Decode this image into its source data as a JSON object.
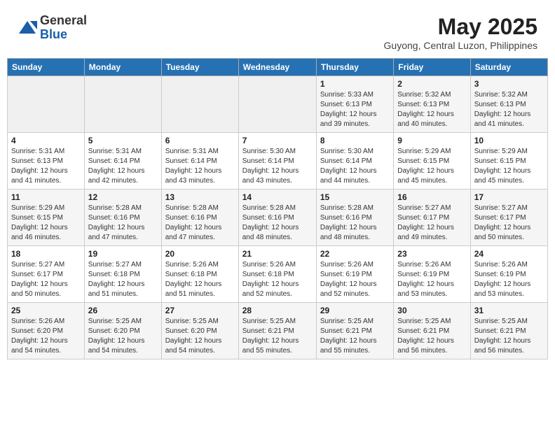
{
  "header": {
    "logo_general": "General",
    "logo_blue": "Blue",
    "month_year": "May 2025",
    "location": "Guyong, Central Luzon, Philippines"
  },
  "weekdays": [
    "Sunday",
    "Monday",
    "Tuesday",
    "Wednesday",
    "Thursday",
    "Friday",
    "Saturday"
  ],
  "weeks": [
    [
      {
        "day": "",
        "info": ""
      },
      {
        "day": "",
        "info": ""
      },
      {
        "day": "",
        "info": ""
      },
      {
        "day": "",
        "info": ""
      },
      {
        "day": "1",
        "info": "Sunrise: 5:33 AM\nSunset: 6:13 PM\nDaylight: 12 hours\nand 39 minutes."
      },
      {
        "day": "2",
        "info": "Sunrise: 5:32 AM\nSunset: 6:13 PM\nDaylight: 12 hours\nand 40 minutes."
      },
      {
        "day": "3",
        "info": "Sunrise: 5:32 AM\nSunset: 6:13 PM\nDaylight: 12 hours\nand 41 minutes."
      }
    ],
    [
      {
        "day": "4",
        "info": "Sunrise: 5:31 AM\nSunset: 6:13 PM\nDaylight: 12 hours\nand 41 minutes."
      },
      {
        "day": "5",
        "info": "Sunrise: 5:31 AM\nSunset: 6:14 PM\nDaylight: 12 hours\nand 42 minutes."
      },
      {
        "day": "6",
        "info": "Sunrise: 5:31 AM\nSunset: 6:14 PM\nDaylight: 12 hours\nand 43 minutes."
      },
      {
        "day": "7",
        "info": "Sunrise: 5:30 AM\nSunset: 6:14 PM\nDaylight: 12 hours\nand 43 minutes."
      },
      {
        "day": "8",
        "info": "Sunrise: 5:30 AM\nSunset: 6:14 PM\nDaylight: 12 hours\nand 44 minutes."
      },
      {
        "day": "9",
        "info": "Sunrise: 5:29 AM\nSunset: 6:15 PM\nDaylight: 12 hours\nand 45 minutes."
      },
      {
        "day": "10",
        "info": "Sunrise: 5:29 AM\nSunset: 6:15 PM\nDaylight: 12 hours\nand 45 minutes."
      }
    ],
    [
      {
        "day": "11",
        "info": "Sunrise: 5:29 AM\nSunset: 6:15 PM\nDaylight: 12 hours\nand 46 minutes."
      },
      {
        "day": "12",
        "info": "Sunrise: 5:28 AM\nSunset: 6:16 PM\nDaylight: 12 hours\nand 47 minutes."
      },
      {
        "day": "13",
        "info": "Sunrise: 5:28 AM\nSunset: 6:16 PM\nDaylight: 12 hours\nand 47 minutes."
      },
      {
        "day": "14",
        "info": "Sunrise: 5:28 AM\nSunset: 6:16 PM\nDaylight: 12 hours\nand 48 minutes."
      },
      {
        "day": "15",
        "info": "Sunrise: 5:28 AM\nSunset: 6:16 PM\nDaylight: 12 hours\nand 48 minutes."
      },
      {
        "day": "16",
        "info": "Sunrise: 5:27 AM\nSunset: 6:17 PM\nDaylight: 12 hours\nand 49 minutes."
      },
      {
        "day": "17",
        "info": "Sunrise: 5:27 AM\nSunset: 6:17 PM\nDaylight: 12 hours\nand 50 minutes."
      }
    ],
    [
      {
        "day": "18",
        "info": "Sunrise: 5:27 AM\nSunset: 6:17 PM\nDaylight: 12 hours\nand 50 minutes."
      },
      {
        "day": "19",
        "info": "Sunrise: 5:27 AM\nSunset: 6:18 PM\nDaylight: 12 hours\nand 51 minutes."
      },
      {
        "day": "20",
        "info": "Sunrise: 5:26 AM\nSunset: 6:18 PM\nDaylight: 12 hours\nand 51 minutes."
      },
      {
        "day": "21",
        "info": "Sunrise: 5:26 AM\nSunset: 6:18 PM\nDaylight: 12 hours\nand 52 minutes."
      },
      {
        "day": "22",
        "info": "Sunrise: 5:26 AM\nSunset: 6:19 PM\nDaylight: 12 hours\nand 52 minutes."
      },
      {
        "day": "23",
        "info": "Sunrise: 5:26 AM\nSunset: 6:19 PM\nDaylight: 12 hours\nand 53 minutes."
      },
      {
        "day": "24",
        "info": "Sunrise: 5:26 AM\nSunset: 6:19 PM\nDaylight: 12 hours\nand 53 minutes."
      }
    ],
    [
      {
        "day": "25",
        "info": "Sunrise: 5:26 AM\nSunset: 6:20 PM\nDaylight: 12 hours\nand 54 minutes."
      },
      {
        "day": "26",
        "info": "Sunrise: 5:25 AM\nSunset: 6:20 PM\nDaylight: 12 hours\nand 54 minutes."
      },
      {
        "day": "27",
        "info": "Sunrise: 5:25 AM\nSunset: 6:20 PM\nDaylight: 12 hours\nand 54 minutes."
      },
      {
        "day": "28",
        "info": "Sunrise: 5:25 AM\nSunset: 6:21 PM\nDaylight: 12 hours\nand 55 minutes."
      },
      {
        "day": "29",
        "info": "Sunrise: 5:25 AM\nSunset: 6:21 PM\nDaylight: 12 hours\nand 55 minutes."
      },
      {
        "day": "30",
        "info": "Sunrise: 5:25 AM\nSunset: 6:21 PM\nDaylight: 12 hours\nand 56 minutes."
      },
      {
        "day": "31",
        "info": "Sunrise: 5:25 AM\nSunset: 6:21 PM\nDaylight: 12 hours\nand 56 minutes."
      }
    ]
  ]
}
